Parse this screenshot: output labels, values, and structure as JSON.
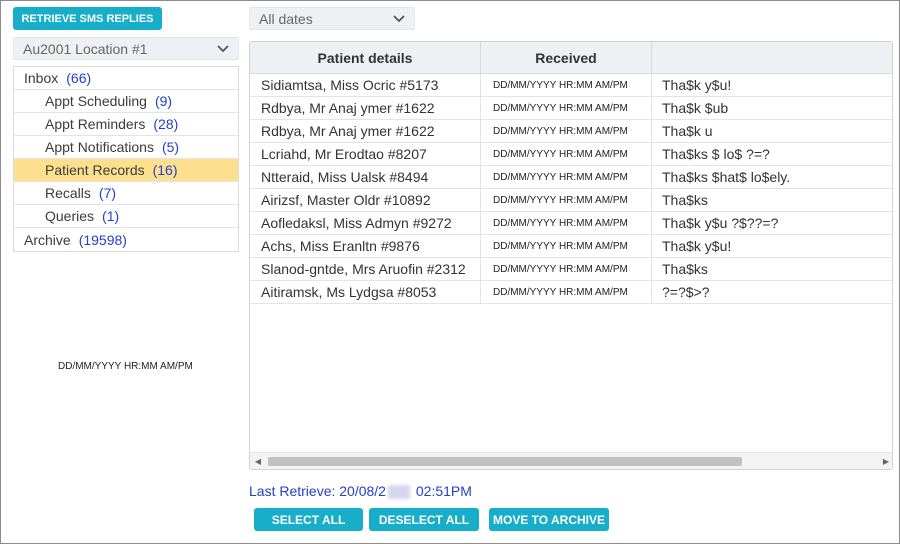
{
  "toolbar": {
    "retrieve_label": "RETRIEVE SMS REPLIES",
    "dates_filter": "All dates"
  },
  "sidebar": {
    "location": "Au2001 Location #1",
    "folders": [
      {
        "label": "Inbox",
        "count": "(66)",
        "level": 0
      },
      {
        "label": "Appt Scheduling",
        "count": "(9)",
        "level": 1
      },
      {
        "label": "Appt Reminders",
        "count": "(28)",
        "level": 1
      },
      {
        "label": "Appt Notifications",
        "count": "(5)",
        "level": 1
      },
      {
        "label": "Patient Records",
        "count": "(16)",
        "level": 1,
        "selected": true
      },
      {
        "label": "Recalls",
        "count": "(7)",
        "level": 1
      },
      {
        "label": "Queries",
        "count": "(1)",
        "level": 1
      },
      {
        "label": "Archive",
        "count": "(19598)",
        "level": 0
      }
    ],
    "timestamp": "DD/MM/YYYY HR:MM AM/PM"
  },
  "grid": {
    "headers": [
      "Patient details",
      "Received",
      ""
    ],
    "rows": [
      {
        "patient": "Sidiamtsa, Miss Ocric #5173",
        "received": "DD/MM/YYYY HR:MM AM/PM",
        "message": "Tha$k y$u!"
      },
      {
        "patient": "Rdbya, Mr Anaj ymer #1622",
        "received": "DD/MM/YYYY HR:MM AM/PM",
        "message": "Tha$k $ub"
      },
      {
        "patient": "Rdbya, Mr Anaj ymer #1622",
        "received": "DD/MM/YYYY HR:MM AM/PM",
        "message": "Tha$k u"
      },
      {
        "patient": "Lcriahd, Mr Erodtao #8207",
        "received": "DD/MM/YYYY HR:MM AM/PM",
        "message": "Tha$ks $ lo$ ?=?"
      },
      {
        "patient": "Ntteraid, Miss Ualsk #8494",
        "received": "DD/MM/YYYY HR:MM AM/PM",
        "message": "Tha$ks $hat$ lo$ely."
      },
      {
        "patient": "Airizsf, Master Oldr #10892",
        "received": "DD/MM/YYYY HR:MM AM/PM",
        "message": "Tha$ks"
      },
      {
        "patient": "Aofledaksl, Miss Admyn #9272",
        "received": "DD/MM/YYYY HR:MM AM/PM",
        "message": "Tha$k y$u ?$??=?"
      },
      {
        "patient": "Achs, Miss Eranltn #9876",
        "received": "DD/MM/YYYY HR:MM AM/PM",
        "message": "Tha$k y$u!"
      },
      {
        "patient": "Slanod-gntde, Mrs Aruofin #2312",
        "received": "DD/MM/YYYY HR:MM AM/PM",
        "message": "Tha$ks"
      },
      {
        "patient": "Aitiramsk, Ms Lydgsa #8053",
        "received": "DD/MM/YYYY HR:MM AM/PM",
        "message": "?=?$>?"
      }
    ]
  },
  "footer": {
    "last_retrieve_label": "Last Retrieve: 20/08/2",
    "last_retrieve_time": "02:51PM",
    "select_all": "SELECT ALL",
    "deselect_all": "DESELECT ALL",
    "move_to_archive": "MOVE TO ARCHIVE"
  },
  "colors": {
    "accent": "#16aec9",
    "selected_row": "#fde08d",
    "link_blue": "#2440c8"
  },
  "icons": {
    "dropdown": "chevron-down-icon",
    "scroll_left": "scroll-left-arrow-icon",
    "scroll_right": "scroll-right-arrow-icon"
  }
}
